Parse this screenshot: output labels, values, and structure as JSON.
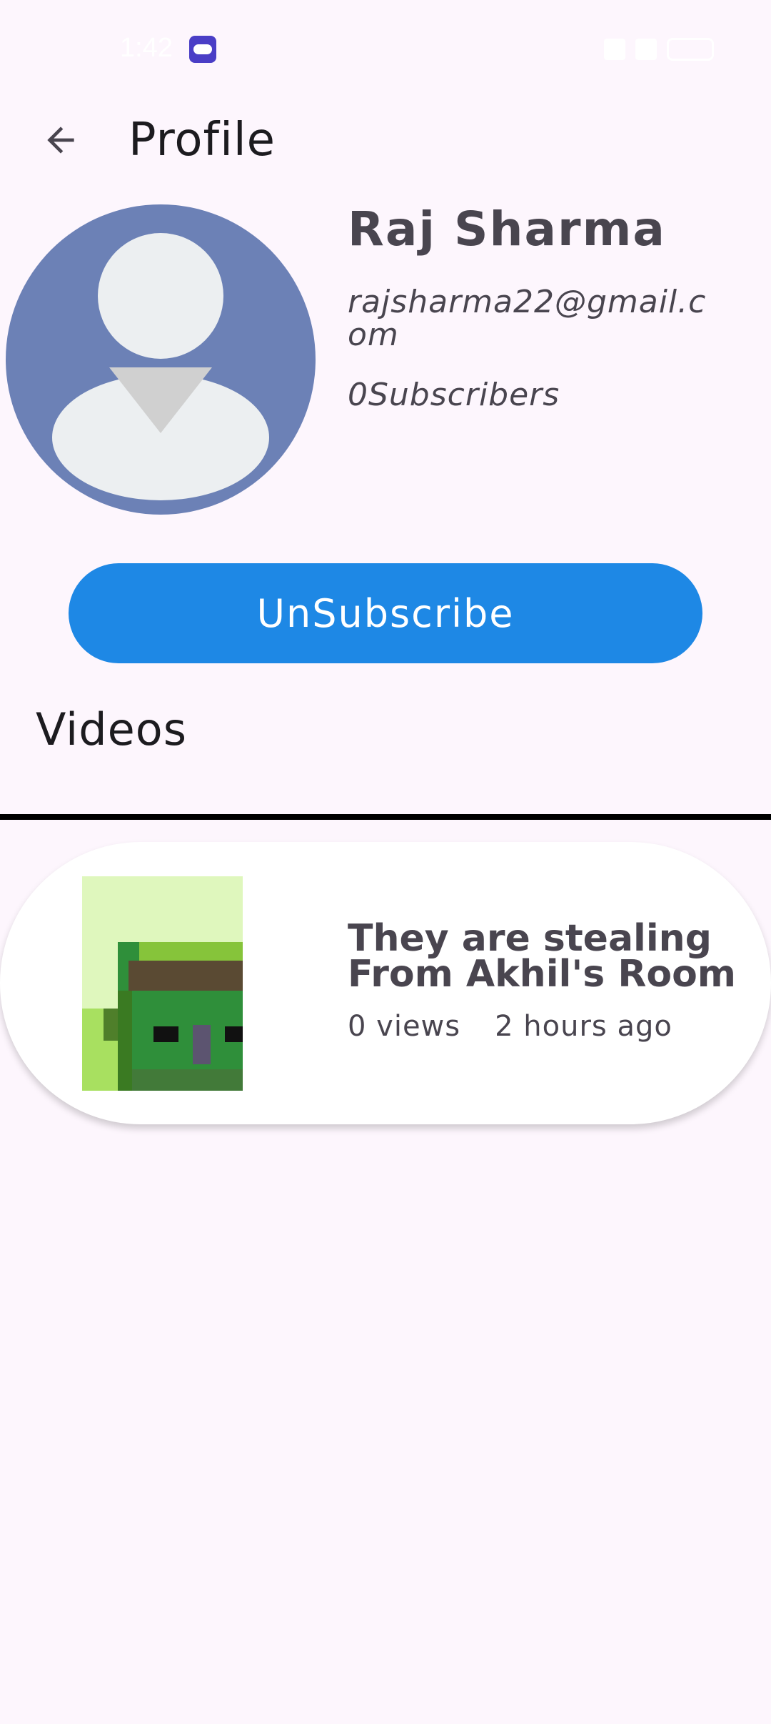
{
  "status_bar": {
    "time": "1:42",
    "icons": [
      "game-icon",
      "alarm-icon",
      "signal-icon",
      "battery-icon"
    ]
  },
  "app_bar": {
    "back_icon": "arrow-left-icon",
    "title": "Profile"
  },
  "profile": {
    "avatar_icon": "person-avatar-icon",
    "name": "Raj Sharma",
    "email": "rajsharma22@gmail.com",
    "subscribers": "0Subscribers"
  },
  "subscribe_button": {
    "label": "UnSubscribe"
  },
  "videos_section": {
    "title": "Videos",
    "items": [
      {
        "title": "They are stealing From Akhil's Room",
        "views": "0 views",
        "posted": "2 hours ago",
        "thumbnail_icon": "pixel-art-thumbnail"
      }
    ]
  },
  "colors": {
    "background": "#fdf6fd",
    "button": "#1e88e5",
    "avatar_bg": "#6c81b6",
    "text_secondary": "#49454f"
  }
}
